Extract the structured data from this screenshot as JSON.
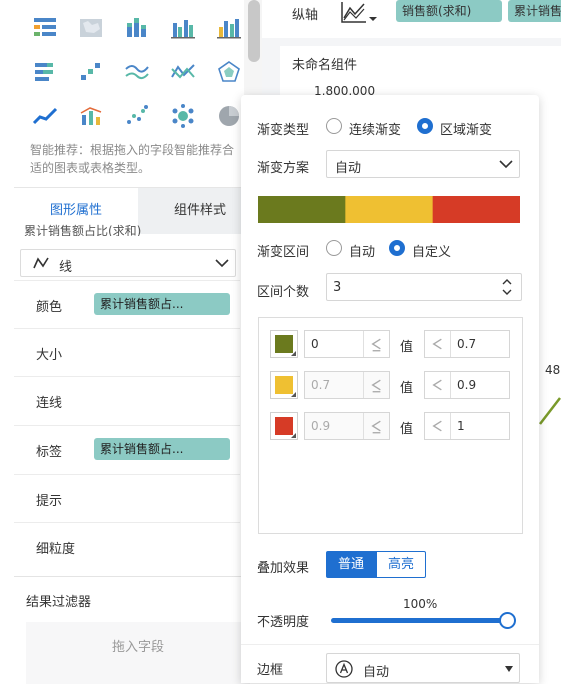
{
  "left": {
    "chart_types": [
      "summary-table-icon",
      "map-icon",
      "stacked-bar-icon",
      "multi-bar-icon",
      "grouped-bar-icon",
      "horizontal-stacked-bar-icon",
      "step-chart-icon",
      "multi-line-icon",
      "line-with-points-icon",
      "radar-icon",
      "area-line-icon",
      "bar-line-combo-icon",
      "scatter-icon",
      "bubble-icon",
      "pie-icon"
    ],
    "recommend_text": "智能推荐：根据拖入的字段智能推荐合适的图表或表格类型。",
    "tabs": {
      "graph_attr": "图形属性",
      "component_style": "组件样式"
    },
    "field_title": "累计销售额占比(求和)",
    "mark_type": "线",
    "props": {
      "color": "颜色",
      "color_field": "累计销售额占...",
      "size": "大小",
      "connect": "连线",
      "label": "标签",
      "label_field": "累计销售额占...",
      "tooltip": "提示",
      "granularity": "细粒度"
    },
    "filter": {
      "title": "结果过滤器",
      "drop_hint": "拖入字段"
    }
  },
  "right": {
    "axis_label": "纵轴",
    "axis_tags": [
      "销售额(求和)",
      "累计销售"
    ],
    "chart_title": "未命名组件",
    "ytick_top": "1,800,000",
    "side_label": "48"
  },
  "popup": {
    "gradient_type_label": "渐变类型",
    "gradient_type_options": [
      "连续渐变",
      "区域渐变"
    ],
    "gradient_type_selected": 1,
    "scheme_label": "渐变方案",
    "scheme_value": "自动",
    "gradient_colors": [
      "#6b7a1e",
      "#efc032",
      "#d63b26"
    ],
    "range_label": "渐变区间",
    "range_options": [
      "自动",
      "自定义"
    ],
    "range_selected": 1,
    "count_label": "区间个数",
    "count_value": "3",
    "value_label": "值",
    "intervals": [
      {
        "color": "#6b7a1e",
        "from": "0",
        "to": "0.7"
      },
      {
        "color": "#efc032",
        "from": "0.7",
        "to": "0.9"
      },
      {
        "color": "#d63b26",
        "from": "0.9",
        "to": "1"
      }
    ],
    "blend_label": "叠加效果",
    "blend_normal": "普通",
    "blend_highlight": "高亮",
    "opacity_label": "不透明度",
    "opacity_value": "100%",
    "opacity_fraction": 1.0,
    "border_label": "边框",
    "border_value": "自动"
  },
  "colors": {
    "accent": "#1f6fd0",
    "pill": "#8ccac4",
    "line_green": "#7a9a2a"
  }
}
